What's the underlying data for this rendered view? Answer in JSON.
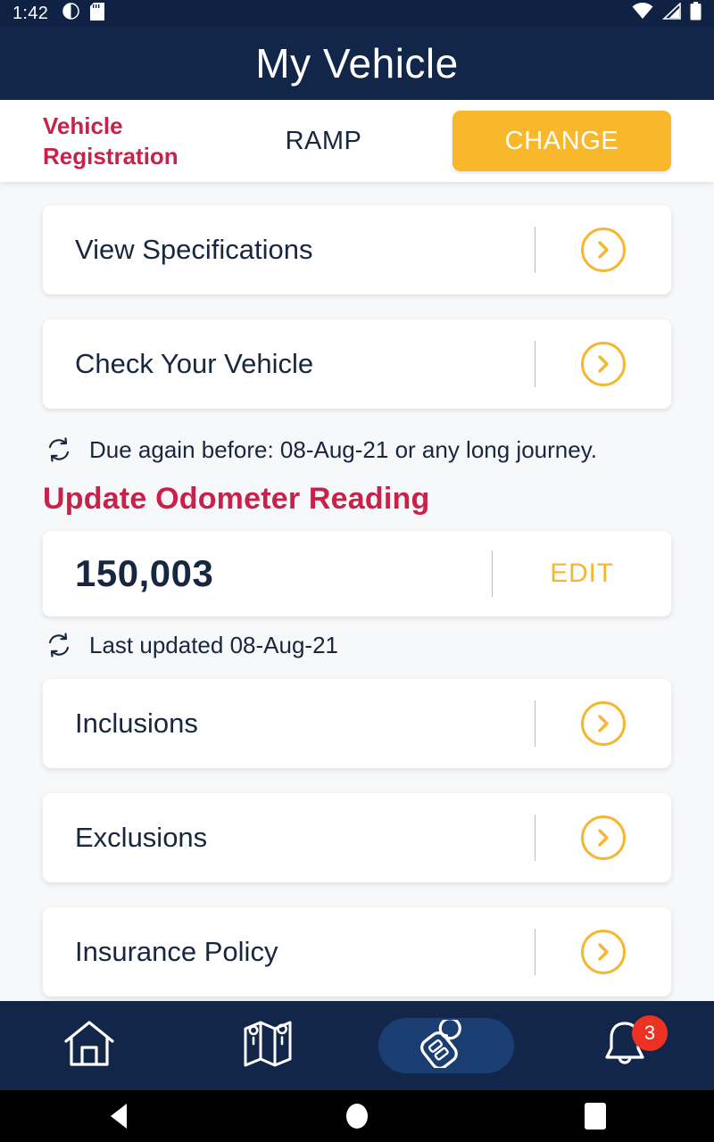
{
  "statusbar": {
    "time": "1:42",
    "left_icons": [
      "do-not-disturb-icon",
      "sd-card-icon"
    ],
    "right_icons": [
      "wifi-icon",
      "cellular-signal-icon",
      "battery-icon"
    ]
  },
  "appbar": {
    "title": "My Vehicle"
  },
  "registration": {
    "label": "Vehicle Registration",
    "plate": "RAMP",
    "change_label": "CHANGE"
  },
  "cards_top": [
    {
      "label": "View Specifications"
    },
    {
      "label": "Check Your Vehicle"
    }
  ],
  "due_note": {
    "icon": "refresh-icon",
    "text": "Due again before: 08-Aug-21 or any long journey."
  },
  "odometer": {
    "section_title": "Update Odometer Reading",
    "value": "150,003",
    "edit_label": "EDIT",
    "last_updated_icon": "refresh-icon",
    "last_updated": "Last updated 08-Aug-21"
  },
  "cards_bottom": [
    {
      "label": "Inclusions"
    },
    {
      "label": "Exclusions"
    },
    {
      "label": "Insurance Policy"
    }
  ],
  "bottom_nav": [
    {
      "name": "home",
      "icon": "home-icon",
      "active": false,
      "badge": ""
    },
    {
      "name": "map",
      "icon": "map-icon",
      "active": false,
      "badge": ""
    },
    {
      "name": "vehicle",
      "icon": "car-key-icon",
      "active": true,
      "badge": ""
    },
    {
      "name": "notifications",
      "icon": "bell-icon",
      "active": false,
      "badge": "3"
    }
  ],
  "system_nav": {
    "back": "back-triangle-icon",
    "home": "home-circle-icon",
    "recents": "recents-square-icon"
  },
  "colors": {
    "navy": "#12264a",
    "crimson": "#c8214a",
    "amber": "#f9b82b",
    "chevron_gold": "#f5b731",
    "badge_red": "#ec3223",
    "page_bg": "#f7f8f9",
    "card_bg": "#ffffff",
    "text_dark": "#17273f",
    "nav_active_pill": "#1b3e72"
  }
}
